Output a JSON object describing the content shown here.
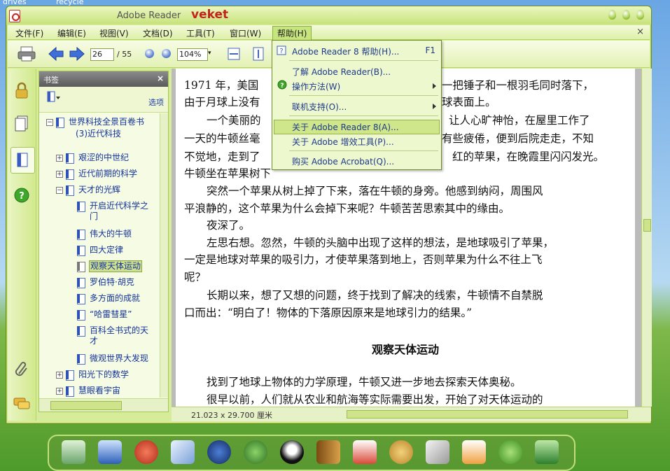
{
  "desktop": {
    "label1": "drives",
    "label2": "recycle"
  },
  "window": {
    "title": "Adobe Reader",
    "title_accent": "veket",
    "accent_color": "#c2231a",
    "theme_color": "#d7ec9a"
  },
  "menubar": {
    "items": [
      "文件(F)",
      "编辑(E)",
      "视图(V)",
      "文档(D)",
      "工具(T)",
      "窗口(W)",
      "帮助(H)"
    ],
    "close_glyph": "×"
  },
  "toolbar": {
    "page_current": "26",
    "page_total": "/ 55",
    "zoom": "104%",
    "icons": [
      "print-icon",
      "back-arrow-icon",
      "forward-arrow-icon",
      "zoom-out-icon",
      "zoom-in-icon",
      "fit-width-icon",
      "fit-page-icon"
    ]
  },
  "bookmarks": {
    "title": "书签",
    "close": "×",
    "options": "选项",
    "nodes": [
      "世界科技全景百卷书",
      "(3)近代科技",
      "艰涩的中世纪",
      "近代前期的科学",
      "天才的光辉",
      "开启近代科学之",
      "门",
      "伟大的牛顿",
      "四大定律",
      "观察天体运动",
      "罗伯特·胡克",
      "多方面的成就",
      "“哈雷彗星”",
      "百科全书式的天",
      "才",
      "微观世界大发现",
      "阳光下的数学",
      "慧眼看宇宙"
    ]
  },
  "document": {
    "lines": [
      "1971 年，美国",
      "一把锤子和一根羽毛同时落下，",
      "由于月球上没有",
      "球表面上。",
      "一个美丽的",
      "让人心旷神怡，在屋里工作了",
      "一天的牛顿丝毫",
      "有些疲倦，便到后院走走，不知",
      "不觉地，走到了",
      "红的苹果，在晚霞里闪闪发光。",
      "牛顿坐在苹果树下",
      "突然一个苹果从树上掉了下来，落在牛顿的身旁。他感到纳闷，周围风",
      "平浪静的，这个苹果为什么会掉下来呢？牛顿苦苦思索其中的缘由。",
      "夜深了。",
      "左思右想。忽然，牛顿的头脑中出现了这样的想法，是地球吸引了苹果，",
      "一定是地球对苹果的吸引力，才使苹果落到地上，否则苹果为什么不往上飞",
      "呢？",
      "长期以来，想了又想的问题，终于找到了解决的线索，牛顿情不自禁脱",
      "口而出：“明白了！物体的下落原因原来是地球引力的结果。”",
      "找到了地球上物体的力学原理，牛顿又进一步地去探索天体奥秘。",
      "很早以前，人们就从农业和航海等实际需要出发，开始了对天体运动的"
    ],
    "heading": "观察天体运动",
    "page_size": "21.023 x 29.700 厘米"
  },
  "help_menu": {
    "items": [
      {
        "label": "Adobe Reader 8 帮助(H)...",
        "shortcut": "F1"
      },
      {
        "label": "了解 Adobe Reader(B)..."
      },
      {
        "label": "操作方法(W)"
      },
      {
        "label": "联机支持(O)..."
      },
      {
        "label": "关于 Adobe Reader 8(A)..."
      },
      {
        "label": "关于 Adobe 增效工具(P)..."
      },
      {
        "label": "购买 Adobe Acrobat(Q)..."
      }
    ]
  },
  "dock": {
    "icons": [
      "drawing-tablet-icon",
      "monitor-icon",
      "pet-icon",
      "pencil-icon",
      "media-player-icon",
      "network-users-icon",
      "penguin-icon",
      "book-icon",
      "chart-icon",
      "palette-icon",
      "usb-drive-icon",
      "photo-card-icon",
      "help-icon",
      "camera-icon"
    ]
  }
}
